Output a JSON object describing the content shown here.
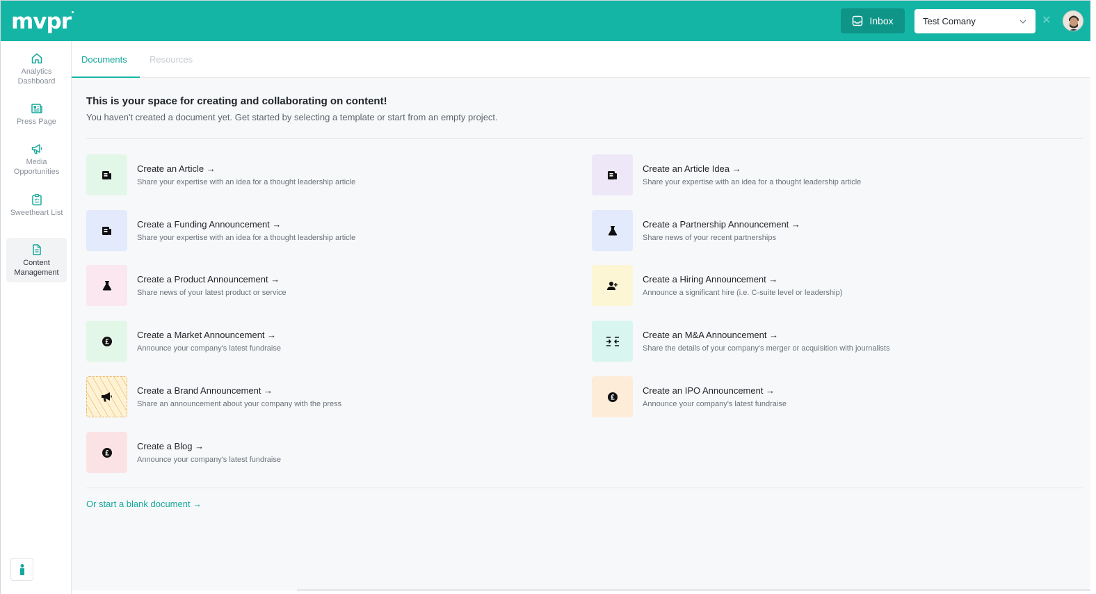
{
  "header": {
    "logo": "mvpr",
    "inbox_label": "Inbox",
    "company_value": "Test Comany",
    "clear_symbol": "✕"
  },
  "sidebar": {
    "items": [
      {
        "label": "Analytics Dashboard",
        "icon": "home-icon",
        "active": false
      },
      {
        "label": "Press Page",
        "icon": "newspaper-icon",
        "active": false
      },
      {
        "label": "Media Opportunities",
        "icon": "megaphone-icon",
        "active": false
      },
      {
        "label": "Sweetheart List",
        "icon": "clipboard-icon",
        "active": false
      },
      {
        "label": "Content Management",
        "icon": "document-icon",
        "active": true
      }
    ],
    "help_icon": "help-icon"
  },
  "tabs": [
    {
      "label": "Documents",
      "active": true
    },
    {
      "label": "Resources",
      "active": false
    }
  ],
  "intro": {
    "title": "This is your space for creating and collaborating on content!",
    "subtitle": "You haven't created a document yet. Get started by selecting a template or start from an empty project."
  },
  "templates": [
    {
      "title": "Create an Article →",
      "desc": "Share your expertise with an idea for a thought leadership article",
      "icon": "article-icon",
      "bg": "#e3f7e8"
    },
    {
      "title": "Create an Article Idea →",
      "desc": "Share your expertise with an idea for a thought leadership article",
      "icon": "article-icon",
      "bg": "#ede7f8"
    },
    {
      "title": "Create a Funding Announcement →",
      "desc": "Share your expertise with an idea for a thought leadership article",
      "icon": "article-icon",
      "bg": "#e2eafb"
    },
    {
      "title": "Create a Partnership Announcement →",
      "desc": "Share news of your recent partnerships",
      "icon": "flask-icon",
      "bg": "#e2eafb"
    },
    {
      "title": "Create a Product Announcement →",
      "desc": "Share news of your latest product or service",
      "icon": "flask-icon",
      "bg": "#fbe7ef"
    },
    {
      "title": "Create a Hiring Announcement →",
      "desc": "Announce a significant hire (i.e. C-suite level or leadership)",
      "icon": "add-person-icon",
      "bg": "#fdf6d5"
    },
    {
      "title": "Create a Market Announcement →",
      "desc": "Announce your company's latest fundraise",
      "icon": "pound-icon",
      "bg": "#e3f7e8"
    },
    {
      "title": "Create an M&A Announcement →",
      "desc": "Share the details of your company's merger or acquisition with journalists",
      "icon": "merge-icon",
      "bg": "#d8f5ef"
    },
    {
      "title": "Create a Brand Announcement →",
      "desc": "Share an announcement about your company with the press",
      "icon": "megaphone-icon",
      "bg": "#fdf3d4"
    },
    {
      "title": "Create an IPO Announcement →",
      "desc": "Announce your company's latest fundraise",
      "icon": "pound-icon",
      "bg": "#fdecd8"
    },
    {
      "title": "Create a Blog →",
      "desc": "Announce your company's latest fundraise",
      "icon": "pound-icon",
      "bg": "#fbe3e5"
    }
  ],
  "blank_link": "Or start a blank document →"
}
